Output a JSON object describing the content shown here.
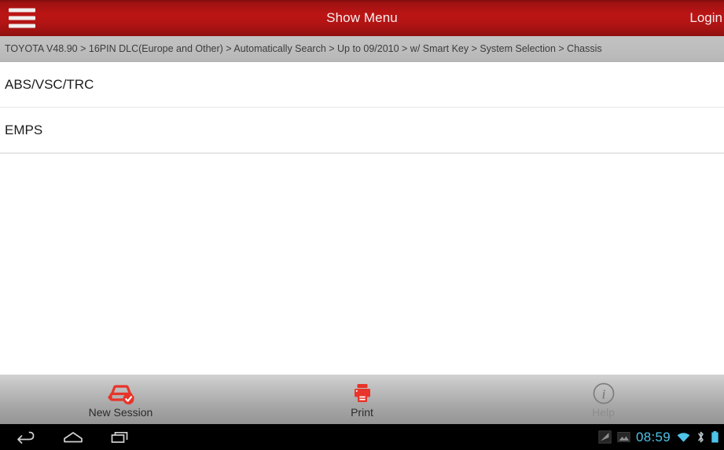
{
  "header": {
    "menu_icon": "hamburger-menu-icon",
    "title": "Show Menu",
    "login_label": "Login",
    "background_color": "#b41414",
    "text_color": "#f6f0f0"
  },
  "breadcrumb": {
    "text": "TOYOTA V48.90 > 16PIN DLC(Europe and Other) > Automatically Search > Up to 09/2010 > w/ Smart Key > System Selection > Chassis",
    "background_color": "#bdbdbd",
    "text_color": "#3c3c3c"
  },
  "menu_list": {
    "items": [
      {
        "label": "ABS/VSC/TRC"
      },
      {
        "label": "EMPS"
      }
    ]
  },
  "toolbar": {
    "items": [
      {
        "label": "New Session",
        "icon": "car-check-icon",
        "enabled": true,
        "color": "#e8342a"
      },
      {
        "label": "Print",
        "icon": "printer-icon",
        "enabled": true,
        "color": "#e8342a"
      },
      {
        "label": "Help",
        "icon": "info-circle-icon",
        "enabled": false,
        "color": "#8d8d8d"
      }
    ]
  },
  "android_navbar": {
    "back_icon": "back-arrow-icon",
    "home_icon": "home-icon",
    "recents_icon": "recent-apps-icon",
    "notification_icons": [
      "screenshot-icon",
      "image-icon"
    ],
    "clock": "08:59",
    "wifi_icon": "wifi-icon",
    "bluetooth_icon": "bluetooth-icon",
    "battery_icon": "battery-icon",
    "accent_color": "#4fc3e8"
  }
}
